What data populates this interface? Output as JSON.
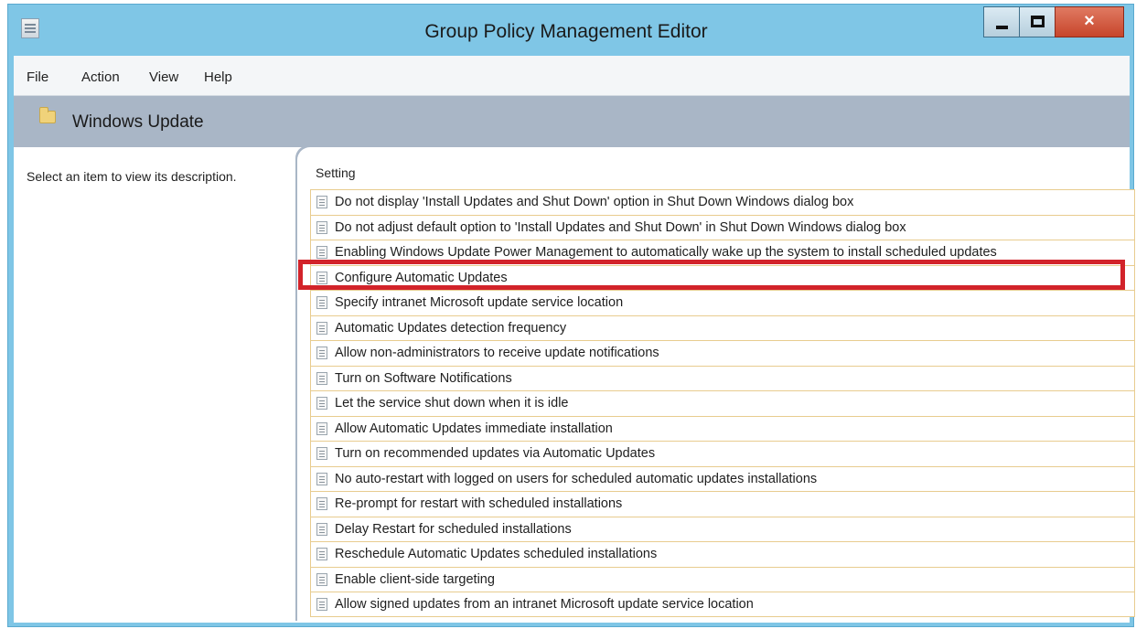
{
  "window": {
    "title": "Group Policy Management Editor",
    "close_glyph": "×",
    "accent_color": "#7fc6e6",
    "highlight_color": "#d2232a"
  },
  "menu": {
    "file": "File",
    "action": "Action",
    "view": "View",
    "help": "Help"
  },
  "header": {
    "title": "Windows Update"
  },
  "left_pane": {
    "description": "Select an item to view its description."
  },
  "settings": {
    "column_header": "Setting",
    "highlighted_item": "Configure Automatic Updates",
    "items": [
      "Do not display 'Install Updates and Shut Down' option in Shut Down Windows dialog box",
      "Do not adjust default option to 'Install Updates and Shut Down' in Shut Down Windows dialog box",
      "Enabling Windows Update Power Management to automatically wake up the system to install scheduled updates",
      "Configure Automatic Updates",
      "Specify intranet Microsoft update service location",
      "Automatic Updates detection frequency",
      "Allow non-administrators to receive update notifications",
      "Turn on Software Notifications",
      "Let the service shut down when it is idle",
      "Allow Automatic Updates immediate installation",
      "Turn on recommended updates via Automatic Updates",
      "No auto-restart with logged on users for scheduled automatic updates installations",
      "Re-prompt for restart with scheduled installations",
      "Delay Restart for scheduled installations",
      "Reschedule Automatic Updates scheduled installations",
      "Enable client-side targeting",
      "Allow signed updates from an intranet Microsoft update service location"
    ]
  }
}
